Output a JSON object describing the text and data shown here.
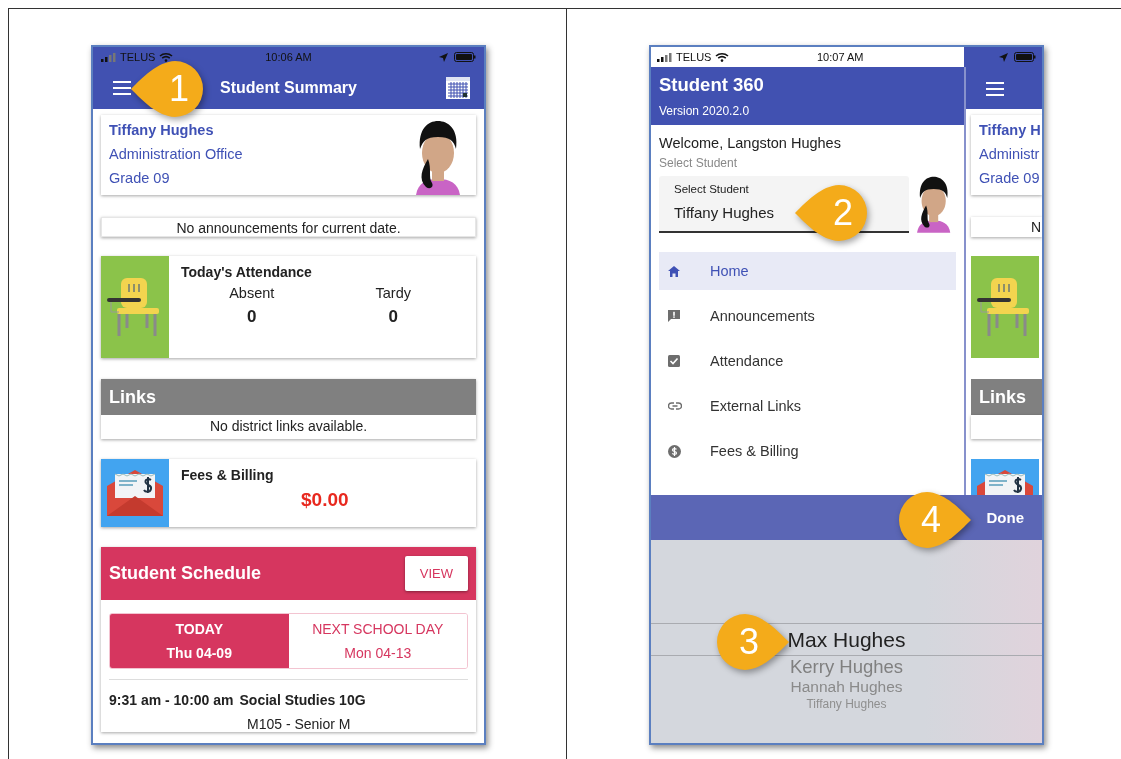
{
  "left_phone": {
    "status_bar": {
      "carrier": "TELUS",
      "time": "10:06 AM"
    },
    "app_bar": {
      "title": "Student Summary"
    },
    "student_card": {
      "name": "Tiffany Hughes",
      "school": "Administration Office",
      "grade": "Grade 09"
    },
    "announcements": {
      "message": "No announcements for current date."
    },
    "attendance": {
      "title": "Today's Attendance",
      "columns": [
        {
          "label": "Absent",
          "value": "0"
        },
        {
          "label": "Tardy",
          "value": "0"
        }
      ]
    },
    "links": {
      "title": "Links",
      "message": "No district links available."
    },
    "fees": {
      "title": "Fees & Billing",
      "amount": "$0.00"
    },
    "schedule": {
      "title": "Student Schedule",
      "view_button": "VIEW",
      "tabs": [
        {
          "label": "TODAY",
          "date": "Thu 04-09",
          "selected": true
        },
        {
          "label": "NEXT SCHOOL DAY",
          "date": "Mon 04-13",
          "selected": false
        }
      ],
      "entries": [
        {
          "time": "9:31 am - 10:00 am",
          "course": "Social Studies 10G",
          "room": "M105 - Senior M"
        }
      ]
    },
    "callouts": [
      {
        "number": "1",
        "kind": "left"
      }
    ]
  },
  "right_phone": {
    "status_bar": {
      "carrier": "TELUS",
      "time": "10:07 AM"
    },
    "drawer": {
      "title": "Student 360",
      "version": "Version 2020.2.0",
      "welcome": "Welcome, Langston Hughes",
      "select_hint": "Select Student",
      "select_field": {
        "label": "Select Student",
        "value": "Tiffany Hughes"
      },
      "nav_items": [
        {
          "label": "Home",
          "kind": "home",
          "selected": true
        },
        {
          "label": "Announcements",
          "kind": "announcement",
          "selected": false
        },
        {
          "label": "Attendance",
          "kind": "check",
          "selected": false
        },
        {
          "label": "External Links",
          "kind": "link",
          "selected": false
        },
        {
          "label": "Fees & Billing",
          "kind": "dollar",
          "selected": false
        }
      ]
    },
    "background_page": {
      "name": "Tiffany H",
      "school": "Administr",
      "grade": "Grade 09",
      "announcement": "N",
      "links_title": "Links"
    },
    "picker": {
      "done_button": "Done",
      "options": [
        {
          "label": "Max Hughes",
          "selected": true
        },
        {
          "label": "Kerry Hughes",
          "selected": false
        },
        {
          "label": "Hannah Hughes",
          "selected": false
        },
        {
          "label": "Tiffany Hughes",
          "selected": false
        }
      ]
    },
    "callouts": [
      {
        "number": "2",
        "kind": "left"
      },
      {
        "number": "3",
        "kind": "right"
      },
      {
        "number": "4",
        "kind": "right"
      }
    ]
  }
}
